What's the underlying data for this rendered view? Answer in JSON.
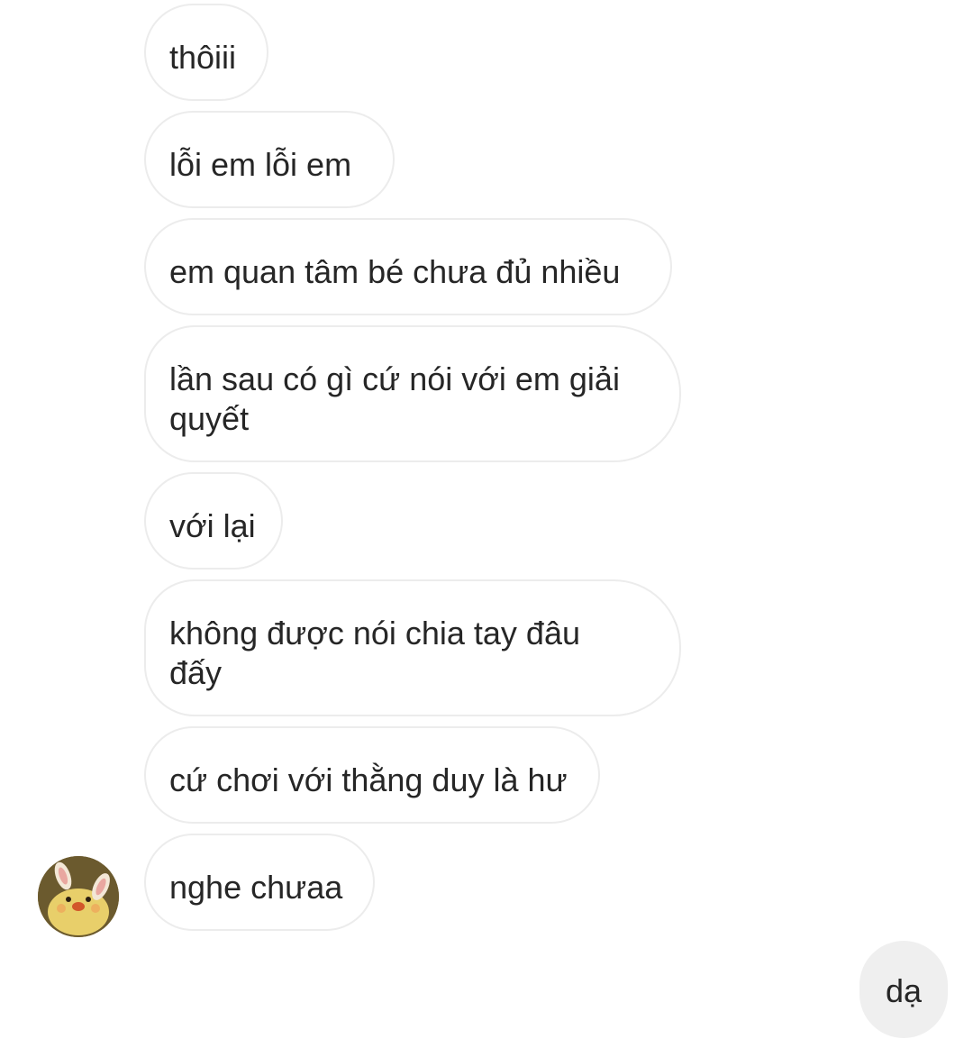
{
  "conversation": {
    "received_messages": [
      "thôiii",
      "lỗi em lỗi em",
      "em quan tâm bé chưa đủ nhiều",
      "lần sau có gì cứ nói với em giải quyết",
      "với lại",
      "không được nói chia tay đâu đấy",
      "cứ chơi với thằng duy là hư",
      "nghe chưaa"
    ],
    "sent_messages": [
      "dạ"
    ],
    "colors": {
      "received_bubble_bg": "#ffffff",
      "received_bubble_border": "#ececec",
      "sent_bubble_bg": "#efefef",
      "text": "#262626"
    },
    "avatar_icon": "contact-avatar-icon"
  }
}
